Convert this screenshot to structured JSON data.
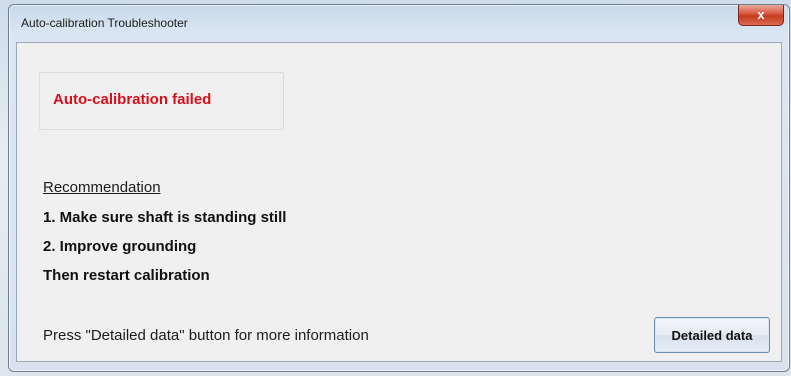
{
  "window": {
    "title": "Auto-calibration Troubleshooter",
    "close_label": "x"
  },
  "status": {
    "message": "Auto-calibration failed",
    "color": "#d4101e"
  },
  "recommendation": {
    "heading": "Recommendation",
    "steps": [
      "1. Make sure shaft is standing still",
      "2. Improve grounding",
      "Then restart calibration"
    ]
  },
  "footer": {
    "info": "Press \"Detailed data\" button for more information",
    "detail_button_label": "Detailed data"
  }
}
